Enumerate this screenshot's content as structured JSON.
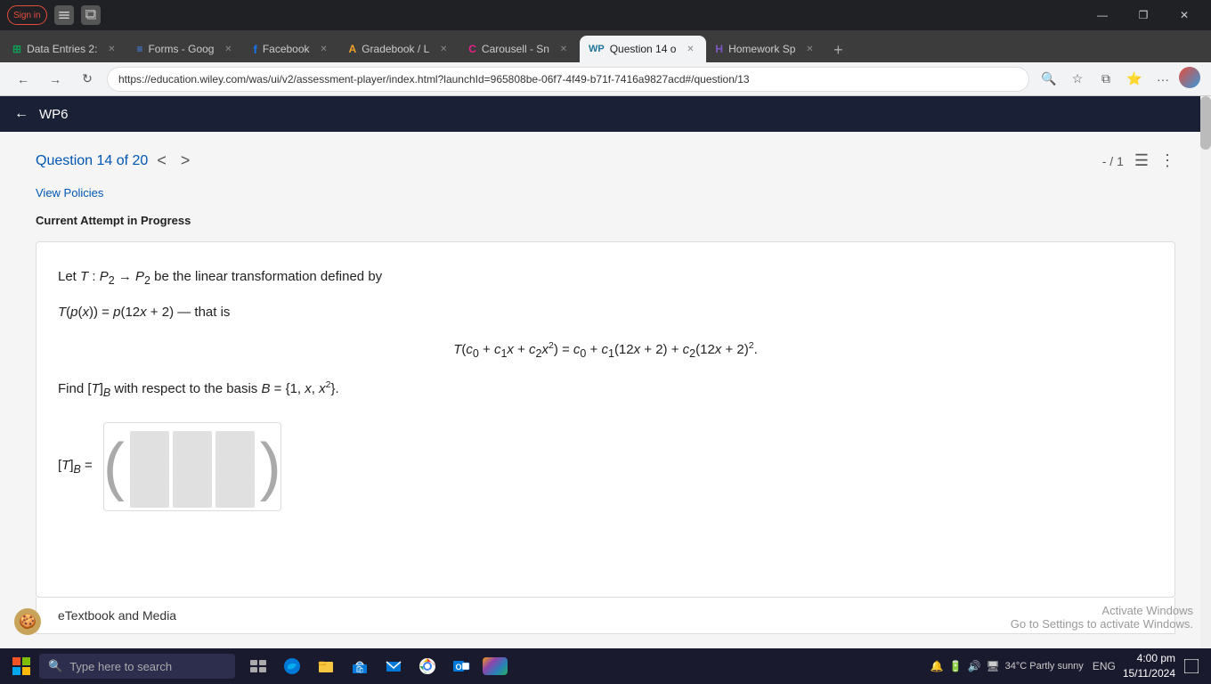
{
  "browser": {
    "tabs": [
      {
        "id": "tab1",
        "label": "Data Entries 2:",
        "favicon": "grid",
        "active": false,
        "favicon_color": "green"
      },
      {
        "id": "tab2",
        "label": "Forms - Goog",
        "favicon": "doc",
        "active": false,
        "favicon_color": "blue"
      },
      {
        "id": "tab3",
        "label": "Facebook",
        "favicon": "fb",
        "active": false,
        "favicon_color": "fb"
      },
      {
        "id": "tab4",
        "label": "Gradebook / L",
        "favicon": "A",
        "active": false,
        "favicon_color": "orange"
      },
      {
        "id": "tab5",
        "label": "Carousell - Sn",
        "favicon": "C",
        "active": false,
        "favicon_color": "pink"
      },
      {
        "id": "tab6",
        "label": "Question 14 o",
        "favicon": "WP",
        "active": true,
        "favicon_color": "wp"
      },
      {
        "id": "tab7",
        "label": "Homework Sp",
        "favicon": "H",
        "active": false,
        "favicon_color": "purple"
      }
    ],
    "address": "https://education.wiley.com/was/ui/v2/assessment-player/index.html?launchId=965808be-06f7-4f49-b71f-7416a9827acd#/question/13",
    "profile_label": "Sign in",
    "window_controls": [
      "—",
      "❐",
      "✕"
    ]
  },
  "topnav": {
    "back_label": "←",
    "title": "WP6"
  },
  "question": {
    "title": "Question 14 of 20",
    "nav_prev": "<",
    "nav_next": ">",
    "score": "- / 1",
    "view_policies_label": "View Policies",
    "attempt_label": "Current Attempt in Progress",
    "math_line1": "Let T : P₂ → P₂ be the linear transformation defined by",
    "math_line2": "T(p(x)) = p(12x + 2) — that is",
    "math_line3": "T(c₀ + c₁x + c₂x²) = c₀ + c₁(12x + 2) + c₂(12x + 2)².",
    "math_line4": "Find [T]_B with respect to the basis B = {1, x, x²}.",
    "matrix_label": "[T]_B =",
    "matrix_rows": 3,
    "matrix_cols": 3
  },
  "bottom": {
    "label": "eTextbook and Media"
  },
  "watermark": {
    "line1": "Activate Windows",
    "line2": "Go to Settings to activate Windows."
  },
  "taskbar": {
    "search_placeholder": "Type here to search",
    "time": "4:00 pm",
    "date": "15/11/2024",
    "weather": "34°C  Partly sunny",
    "language": "ENG"
  }
}
